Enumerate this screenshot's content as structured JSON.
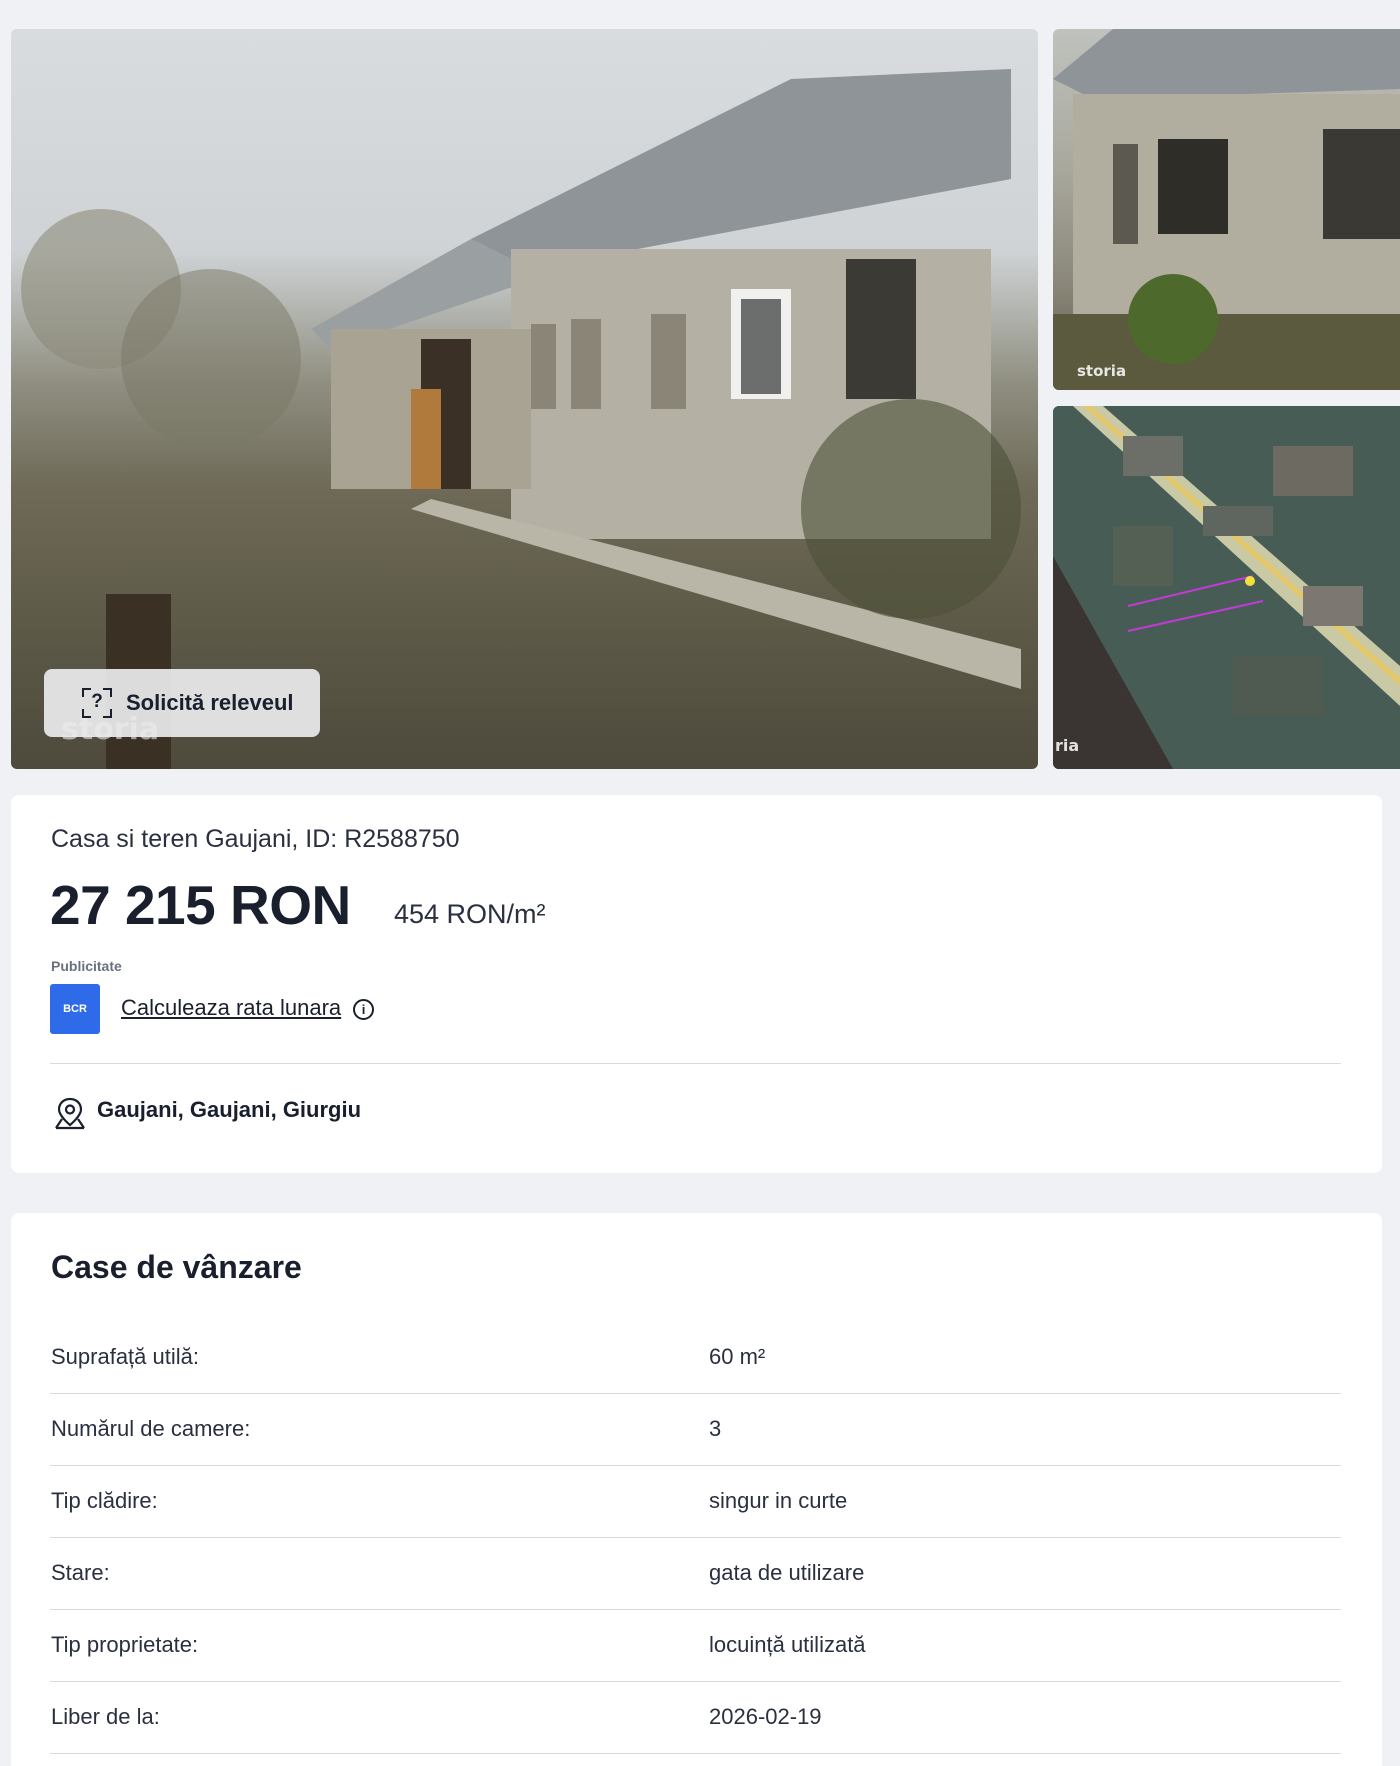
{
  "gallery": {
    "main_watermark": "storia",
    "thumb1_watermark": "storia",
    "thumb2_watermark": "ria",
    "relevu_button_label": "Solicită releveul",
    "relevu_icon_glyph": "?"
  },
  "summary": {
    "title": "Casa si teren Gaujani, ID: R2588750",
    "price": "27 215 RON",
    "price_per_m2": "454 RON/m²",
    "ad_label": "Publicitate",
    "bank_logo_text": "BCR",
    "calc_link": "Calculeaza rata lunara",
    "info_glyph": "i",
    "location": "Gaujani, Gaujani, Giurgiu"
  },
  "details": {
    "heading": "Case de vânzare",
    "rows": [
      {
        "key": "Suprafață utilă:",
        "value": "60 m²"
      },
      {
        "key": "Numărul de camere:",
        "value": "3"
      },
      {
        "key": "Tip clădire:",
        "value": "singur in curte"
      },
      {
        "key": "Stare:",
        "value": "gata de utilizare"
      },
      {
        "key": "Tip proprietate:",
        "value": "locuință utilizată"
      },
      {
        "key": "Liber de la:",
        "value": "2026-02-19"
      }
    ]
  },
  "colors": {
    "page_bg": "#eff1f4",
    "card_bg": "#ffffff",
    "text": "#1a1f2e",
    "bcr_blue": "#2f6be8",
    "divider": "#d8dbe0"
  }
}
